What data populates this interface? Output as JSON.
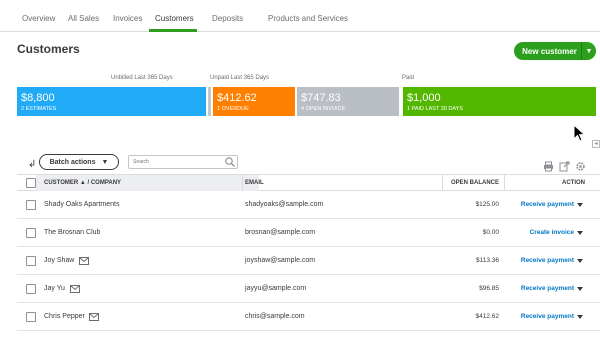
{
  "tabs": [
    {
      "label": "Overview"
    },
    {
      "label": "All Sales"
    },
    {
      "label": "Invoices"
    },
    {
      "label": "Customers"
    },
    {
      "label": "Deposits"
    },
    {
      "label": "Products and Services"
    }
  ],
  "active_tab": "Customers",
  "page_title": "Customers",
  "new_customer_button": "New customer",
  "money_bar": {
    "unbilled_label": "Unbilled Last 365 Days",
    "unpaid_label": "Unpaid Last 365 Days",
    "paid_label": "Paid",
    "segments": [
      {
        "amount": "$8,800",
        "caption": "2 ESTIMATES",
        "color": "#21abf6"
      },
      {
        "amount": "$412.62",
        "caption": "1 OVERDUE",
        "color": "#ff8000"
      },
      {
        "amount": "$747.83",
        "caption": "4 OPEN INVOICE",
        "color": "#babec5"
      },
      {
        "amount": "$1,000",
        "caption": "1 PAID LAST 30 DAYS",
        "color": "#53b700"
      }
    ]
  },
  "toolbar": {
    "batch_actions": "Batch actions",
    "search_placeholder": "Search"
  },
  "table": {
    "headers": {
      "customer": "CUSTOMER ▲ / COMPANY",
      "email": "EMAIL",
      "open_balance": "OPEN BALANCE",
      "action": "ACTION"
    },
    "rows": [
      {
        "name": "Shady Oaks Apartments",
        "has_mail_icon": false,
        "email": "shadyoaks@sample.com",
        "balance": "$125.00",
        "action": "Receive payment"
      },
      {
        "name": "The Brosnan Club",
        "has_mail_icon": false,
        "email": "brosnan@sample.com",
        "balance": "$0.00",
        "action": "Create invoice"
      },
      {
        "name": "Joy Shaw",
        "has_mail_icon": true,
        "email": "joyshaw@sample.com",
        "balance": "$113.36",
        "action": "Receive payment"
      },
      {
        "name": "Jay Yu",
        "has_mail_icon": true,
        "email": "jayyu@sample.com",
        "balance": "$96.85",
        "action": "Receive payment"
      },
      {
        "name": "Chris Pepper",
        "has_mail_icon": true,
        "email": "chris@sample.com",
        "balance": "$412.62",
        "action": "Receive payment"
      }
    ]
  },
  "colors": {
    "brand_green": "#2ca01c",
    "link_blue": "#0077c5"
  }
}
